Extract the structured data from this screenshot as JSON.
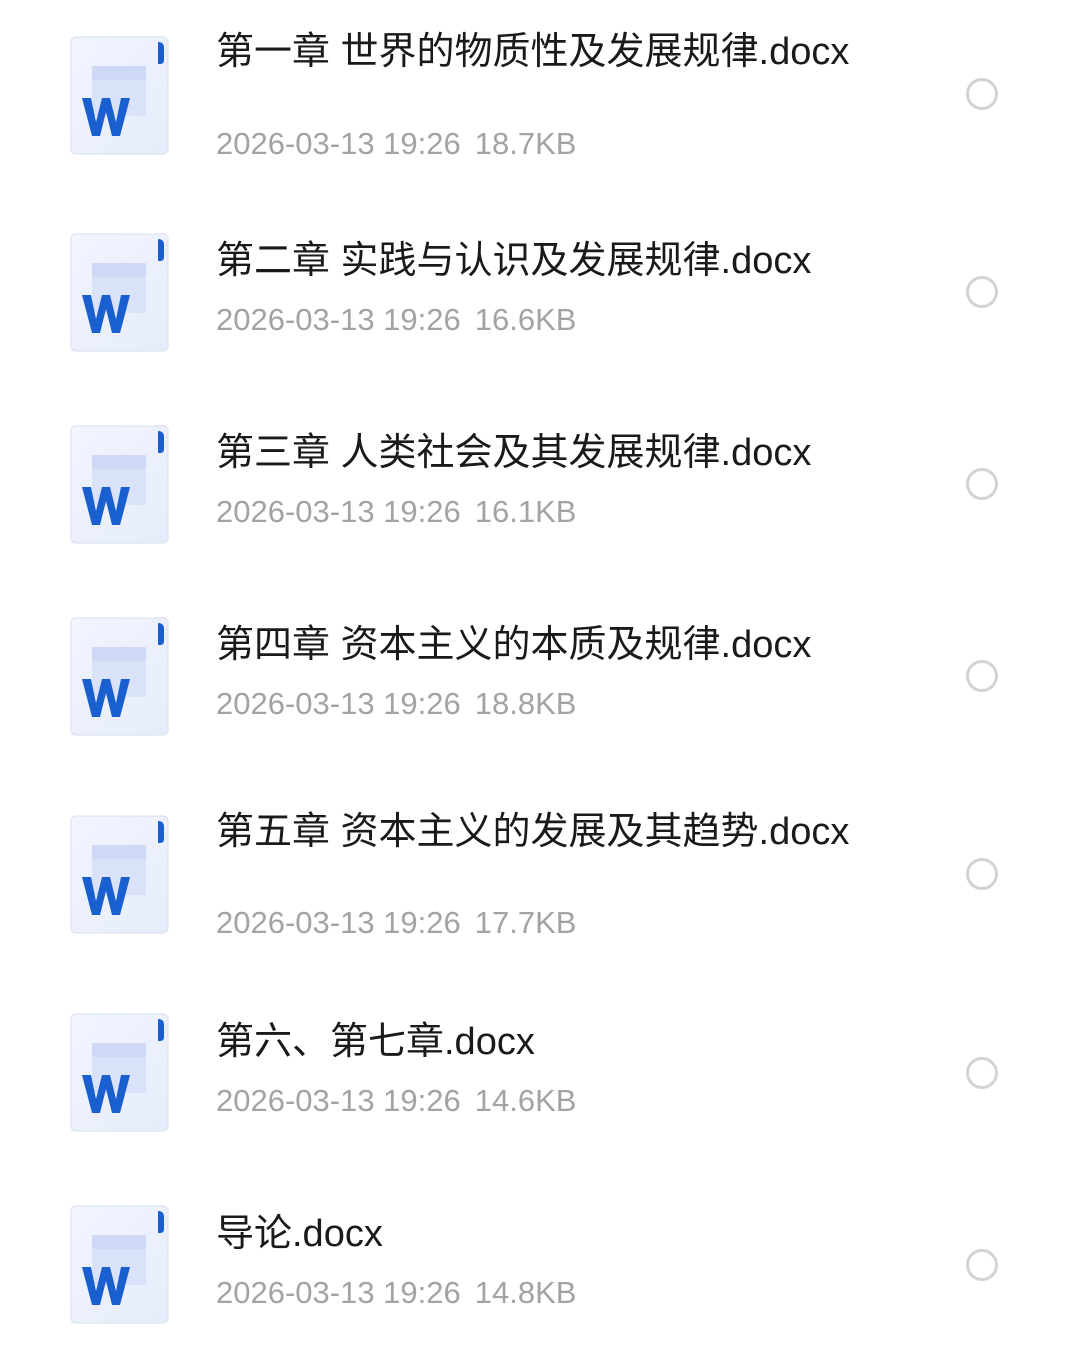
{
  "files": [
    {
      "name": "第一章 世界的物质性及发展规律.docx",
      "date": "2026-03-13 19:26",
      "size": "18.7KB",
      "selected": false,
      "icon": "word-doc-icon"
    },
    {
      "name": "第二章 实践与认识及发展规律.docx",
      "date": "2026-03-13 19:26",
      "size": "16.6KB",
      "selected": false,
      "icon": "word-doc-icon"
    },
    {
      "name": "第三章 人类社会及其发展规律.docx",
      "date": "2026-03-13 19:26",
      "size": "16.1KB",
      "selected": false,
      "icon": "word-doc-icon"
    },
    {
      "name": "第四章 资本主义的本质及规律.docx",
      "date": "2026-03-13 19:26",
      "size": "18.8KB",
      "selected": false,
      "icon": "word-doc-icon"
    },
    {
      "name": "第五章 资本主义的发展及其趋势.docx",
      "date": "2026-03-13 19:26",
      "size": "17.7KB",
      "selected": false,
      "icon": "word-doc-icon"
    },
    {
      "name": "第六、第七章.docx",
      "date": "2026-03-13 19:26",
      "size": "14.6KB",
      "selected": false,
      "icon": "word-doc-icon"
    },
    {
      "name": "导论.docx",
      "date": "2026-03-13 19:26",
      "size": "14.8KB",
      "selected": false,
      "icon": "word-doc-icon"
    }
  ],
  "colors": {
    "word_blue": "#1a5fd0",
    "name_text": "#1a1a1a",
    "meta_text": "#a3a3a3",
    "radio_border": "#d3d3d3"
  }
}
